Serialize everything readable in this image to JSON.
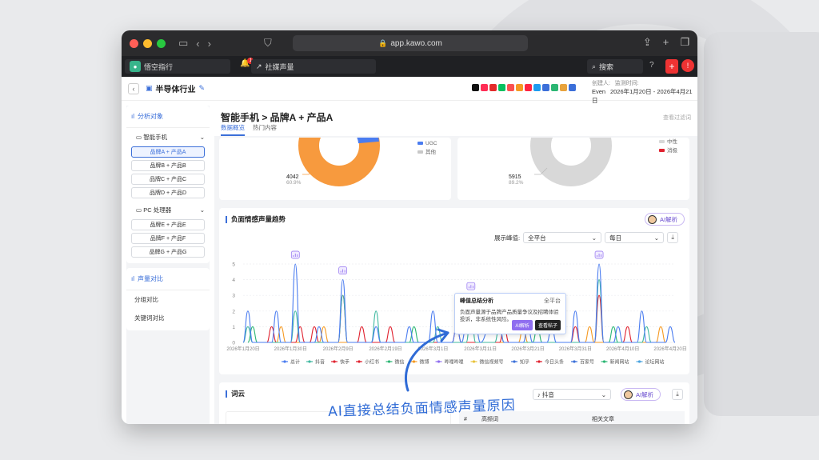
{
  "browser": {
    "url": "app.kawo.com"
  },
  "appbar": {
    "workspace": "悟空指行",
    "notification_count": "1",
    "module": "社媒声量",
    "search_label": "搜索",
    "plus": "+",
    "alert": "!"
  },
  "page": {
    "title": "半导体行业",
    "creator_label": "创建人:",
    "creator": "Even",
    "period_label": "监测时间:",
    "period": "2026年1月20日 - 2026年4月21日"
  },
  "platform_icon_colors": [
    "#111111",
    "#ff2d55",
    "#e32b2b",
    "#07c160",
    "#fa5151",
    "#f59a23",
    "#ff2442",
    "#1d9bf0",
    "#3b6fd9",
    "#2bb673",
    "#e8a33d",
    "#3b6fd9"
  ],
  "sidebar": {
    "analysis_title": "分析对象",
    "groups": [
      {
        "label": "智能手机",
        "items": [
          "品牌A + 产品A",
          "品牌B + 产品B",
          "品牌C + 产品C",
          "品牌D + 产品D"
        ]
      },
      {
        "label": "PC 处理器",
        "items": [
          "品牌E + 产品E",
          "品牌F + 产品F",
          "品牌G + 产品G"
        ]
      }
    ],
    "compare_title": "声量对比",
    "compare_items": [
      "分组对比",
      "关键词对比"
    ]
  },
  "main": {
    "title": "智能手机 > 品牌A + 产品A",
    "view_filter": "查看过滤词",
    "tabs": [
      "数据概览",
      "热门内容"
    ]
  },
  "donut1": {
    "value": "4042",
    "pct": "60.9%",
    "legend": [
      "UGC",
      "其他"
    ],
    "colors": [
      "#f79a3e",
      "#4a7cf0",
      "#c8c8c8"
    ]
  },
  "donut2": {
    "value": "5915",
    "pct": "89.2%",
    "legend": [
      "中性",
      "消极"
    ],
    "colors": [
      "#d8d8d8",
      "#e0222f"
    ]
  },
  "trend": {
    "title": "负面情感声量趋势",
    "ai_label": "AI解析",
    "peak_label": "展示峰值:",
    "platform_select": "全平台",
    "interval_select": "每日",
    "tooltip": {
      "title": "峰值总结分析",
      "platform": "全平台",
      "body": "负面声量源于品牌产品质量争议及招聘体验投诉，非系统性风险。",
      "ai_btn": "AI解析",
      "view_btn": "查看帖子"
    }
  },
  "chart_data": {
    "type": "line",
    "ylim": [
      0,
      5
    ],
    "yticks": [
      "0",
      "1",
      "2",
      "3",
      "4",
      "5"
    ],
    "xticks": [
      "2026年1月20日",
      "2026年1月30日",
      "2026年2月9日",
      "2026年2月19日",
      "2026年3月1日",
      "2026年3月11日",
      "2026年3月21日",
      "2026年3月31日",
      "2026年4月10日",
      "2026年4月20日"
    ],
    "legend": [
      "总计",
      "抖音",
      "快手",
      "小红书",
      "微信",
      "微博",
      "哔哩哔哩",
      "微信视频号",
      "知乎",
      "今日头条",
      "百家号",
      "新闻网站",
      "论坛网站"
    ],
    "colors": [
      "#4a7cf0",
      "#3fb8a0",
      "#e0222f",
      "#e0222f",
      "#2bb673",
      "#f59a23",
      "#8f6ef0",
      "#e8c33d",
      "#3b6fd9",
      "#e0222f",
      "#3b6fd9",
      "#2bb673",
      "#4aa3df"
    ],
    "days": 92,
    "series": [
      {
        "name": "总计",
        "points": [
          [
            1,
            0
          ],
          [
            2,
            2
          ],
          [
            3,
            0
          ],
          [
            7,
            0
          ],
          [
            8,
            2
          ],
          [
            9,
            0
          ],
          [
            11,
            0
          ],
          [
            12,
            5
          ],
          [
            13,
            0
          ],
          [
            16,
            0
          ],
          [
            17,
            1
          ],
          [
            18,
            0
          ],
          [
            21,
            0
          ],
          [
            22,
            4
          ],
          [
            23,
            0
          ],
          [
            28,
            0
          ],
          [
            29,
            1
          ],
          [
            30,
            0
          ],
          [
            35,
            0
          ],
          [
            36,
            1
          ],
          [
            37,
            0
          ],
          [
            40,
            0
          ],
          [
            41,
            2
          ],
          [
            42,
            0
          ],
          [
            45,
            0
          ],
          [
            46,
            1
          ],
          [
            47,
            0
          ],
          [
            48,
            1
          ],
          [
            49,
            3
          ],
          [
            50,
            1
          ],
          [
            51,
            0
          ],
          [
            53,
            1
          ],
          [
            54,
            2
          ],
          [
            55,
            1
          ],
          [
            56,
            0
          ],
          [
            60,
            0
          ],
          [
            61,
            1
          ],
          [
            62,
            0
          ],
          [
            65,
            0
          ],
          [
            66,
            1
          ],
          [
            67,
            0
          ],
          [
            70,
            0
          ],
          [
            71,
            2
          ],
          [
            72,
            0
          ],
          [
            75,
            0
          ],
          [
            76,
            5
          ],
          [
            77,
            0
          ],
          [
            79,
            0
          ],
          [
            80,
            1
          ],
          [
            81,
            0
          ],
          [
            84,
            0
          ],
          [
            85,
            2
          ],
          [
            86,
            0
          ],
          [
            90,
            0
          ],
          [
            91,
            1
          ],
          [
            92,
            0
          ]
        ]
      },
      {
        "name": "抖音",
        "points": [
          [
            1,
            0
          ],
          [
            2,
            1
          ],
          [
            3,
            0
          ],
          [
            11,
            0
          ],
          [
            12,
            2
          ],
          [
            13,
            0
          ],
          [
            21,
            0
          ],
          [
            22,
            3
          ],
          [
            23,
            0
          ],
          [
            28,
            0
          ],
          [
            29,
            2
          ],
          [
            30,
            0
          ],
          [
            41,
            0
          ],
          [
            42,
            1
          ],
          [
            43,
            0
          ],
          [
            48,
            0
          ],
          [
            49,
            2
          ],
          [
            50,
            0
          ],
          [
            54,
            0
          ],
          [
            55,
            1
          ],
          [
            56,
            0
          ],
          [
            75,
            0
          ],
          [
            76,
            4
          ],
          [
            77,
            0
          ],
          [
            85,
            0
          ],
          [
            86,
            1
          ],
          [
            87,
            0
          ]
        ]
      },
      {
        "name": "快手",
        "points": [
          [
            6,
            0
          ],
          [
            7,
            1
          ],
          [
            8,
            0
          ],
          [
            12,
            0
          ],
          [
            13,
            1
          ],
          [
            14,
            0
          ],
          [
            15,
            0
          ],
          [
            16,
            1
          ],
          [
            17,
            0
          ],
          [
            21,
            0
          ],
          [
            22,
            3
          ],
          [
            23,
            0
          ],
          [
            25,
            0
          ],
          [
            26,
            1
          ],
          [
            27,
            0
          ],
          [
            31,
            0
          ],
          [
            32,
            1
          ],
          [
            33,
            0
          ],
          [
            45,
            0
          ],
          [
            46,
            1
          ],
          [
            47,
            0
          ],
          [
            55,
            0
          ],
          [
            56,
            1
          ],
          [
            57,
            0
          ],
          [
            70,
            0
          ],
          [
            71,
            1
          ],
          [
            72,
            0
          ],
          [
            75,
            0
          ],
          [
            76,
            3
          ],
          [
            77,
            0
          ],
          [
            81,
            0
          ],
          [
            82,
            1
          ],
          [
            83,
            0
          ]
        ]
      },
      {
        "name": "微博",
        "points": [
          [
            8,
            0
          ],
          [
            9,
            1
          ],
          [
            10,
            0
          ],
          [
            17,
            0
          ],
          [
            18,
            1
          ],
          [
            19,
            0
          ],
          [
            59,
            0
          ],
          [
            60,
            1
          ],
          [
            61,
            0
          ],
          [
            73,
            0
          ],
          [
            74,
            1
          ],
          [
            75,
            0
          ],
          [
            88,
            0
          ],
          [
            89,
            1
          ],
          [
            90,
            0
          ]
        ]
      },
      {
        "name": "微信",
        "points": [
          [
            2,
            0
          ],
          [
            3,
            1
          ],
          [
            4,
            0
          ],
          [
            36,
            0
          ],
          [
            37,
            1
          ],
          [
            38,
            0
          ],
          [
            62,
            0
          ],
          [
            63,
            1
          ],
          [
            64,
            0
          ],
          [
            78,
            0
          ],
          [
            79,
            1
          ],
          [
            80,
            0
          ]
        ]
      }
    ]
  },
  "wordcloud": {
    "title": "词云",
    "platform_select": "抖音",
    "ai_label": "AI解析",
    "col_index": "#",
    "col_word": "高频词",
    "col_post": "相关文章"
  },
  "annotation": {
    "text": "AI直接总结负面情感声量原因"
  }
}
